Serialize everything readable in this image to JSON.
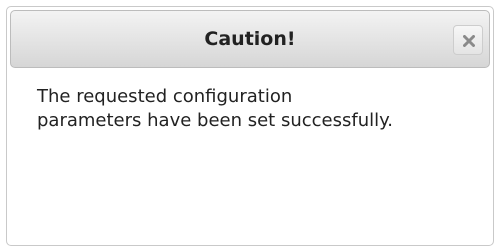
{
  "dialog": {
    "title": "Caution!",
    "message": "The requested configuration parameters have been set successfully.",
    "close_icon": "close-icon"
  }
}
